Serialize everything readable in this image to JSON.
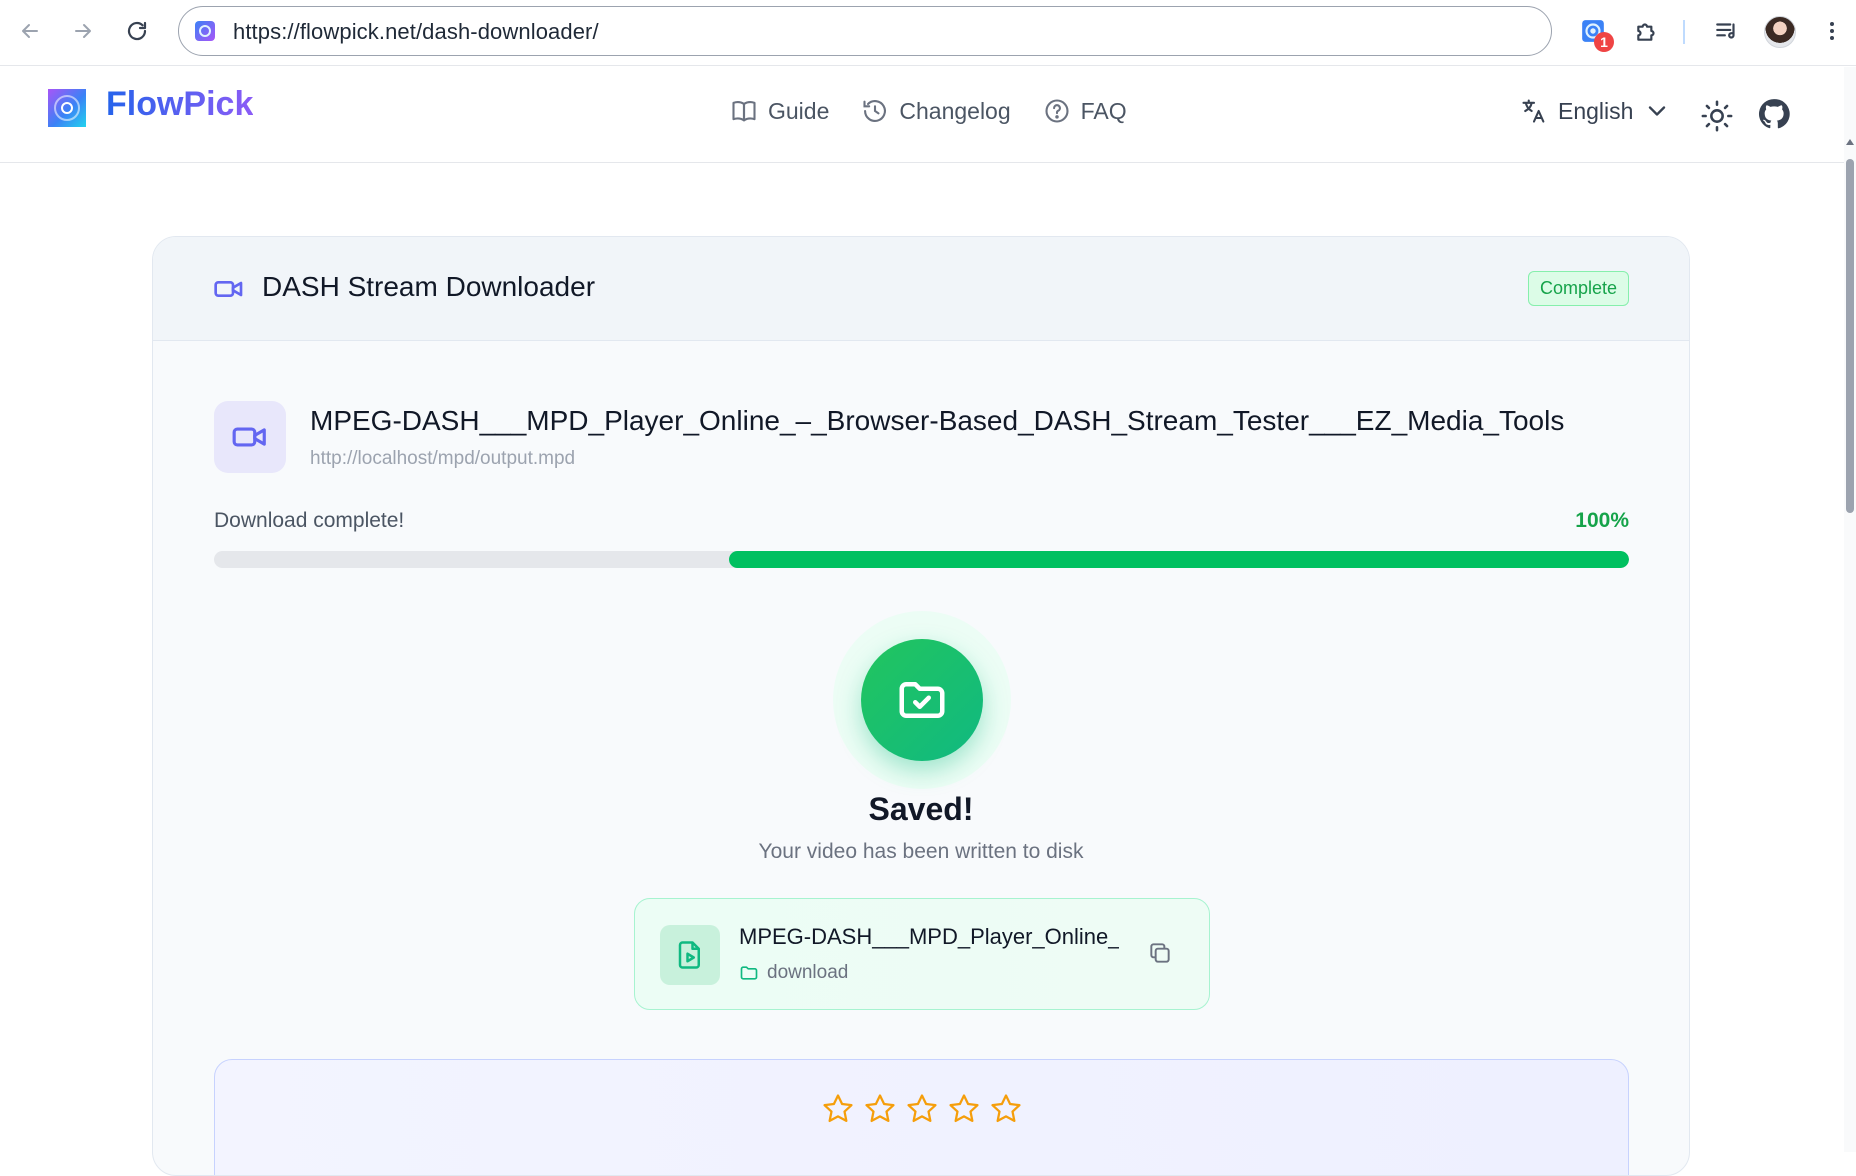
{
  "browser": {
    "url": "https://flowpick.net/dash-downloader/",
    "extension_badge": "1"
  },
  "site": {
    "logo_text": "FlowPick",
    "nav": [
      {
        "label": "Guide",
        "icon": "book-icon"
      },
      {
        "label": "Changelog",
        "icon": "history-icon"
      },
      {
        "label": "FAQ",
        "icon": "help-circle-icon"
      }
    ],
    "language": "English"
  },
  "card": {
    "title": "DASH Stream Downloader",
    "status": "Complete",
    "file_title": "MPEG-DASH___MPD_Player_Online_–_Browser-Based_DASH_Stream_Tester___EZ_Media_Tools",
    "file_url": "http://localhost/mpd/output.mpd",
    "progress_label": "Download complete!",
    "progress_text": "100%",
    "progress_value": 100,
    "saved_title": "Saved!",
    "saved_subtitle": "Your video has been written to disk",
    "result_name": "MPEG-DASH___MPD_Player_Online_–...",
    "result_folder": "download"
  },
  "rating": {
    "stars": 5,
    "filled": 0
  },
  "colors": {
    "accent": "#6366f1",
    "success": "#16a34a",
    "progress": "#00c060",
    "star": "#f59e0b"
  }
}
